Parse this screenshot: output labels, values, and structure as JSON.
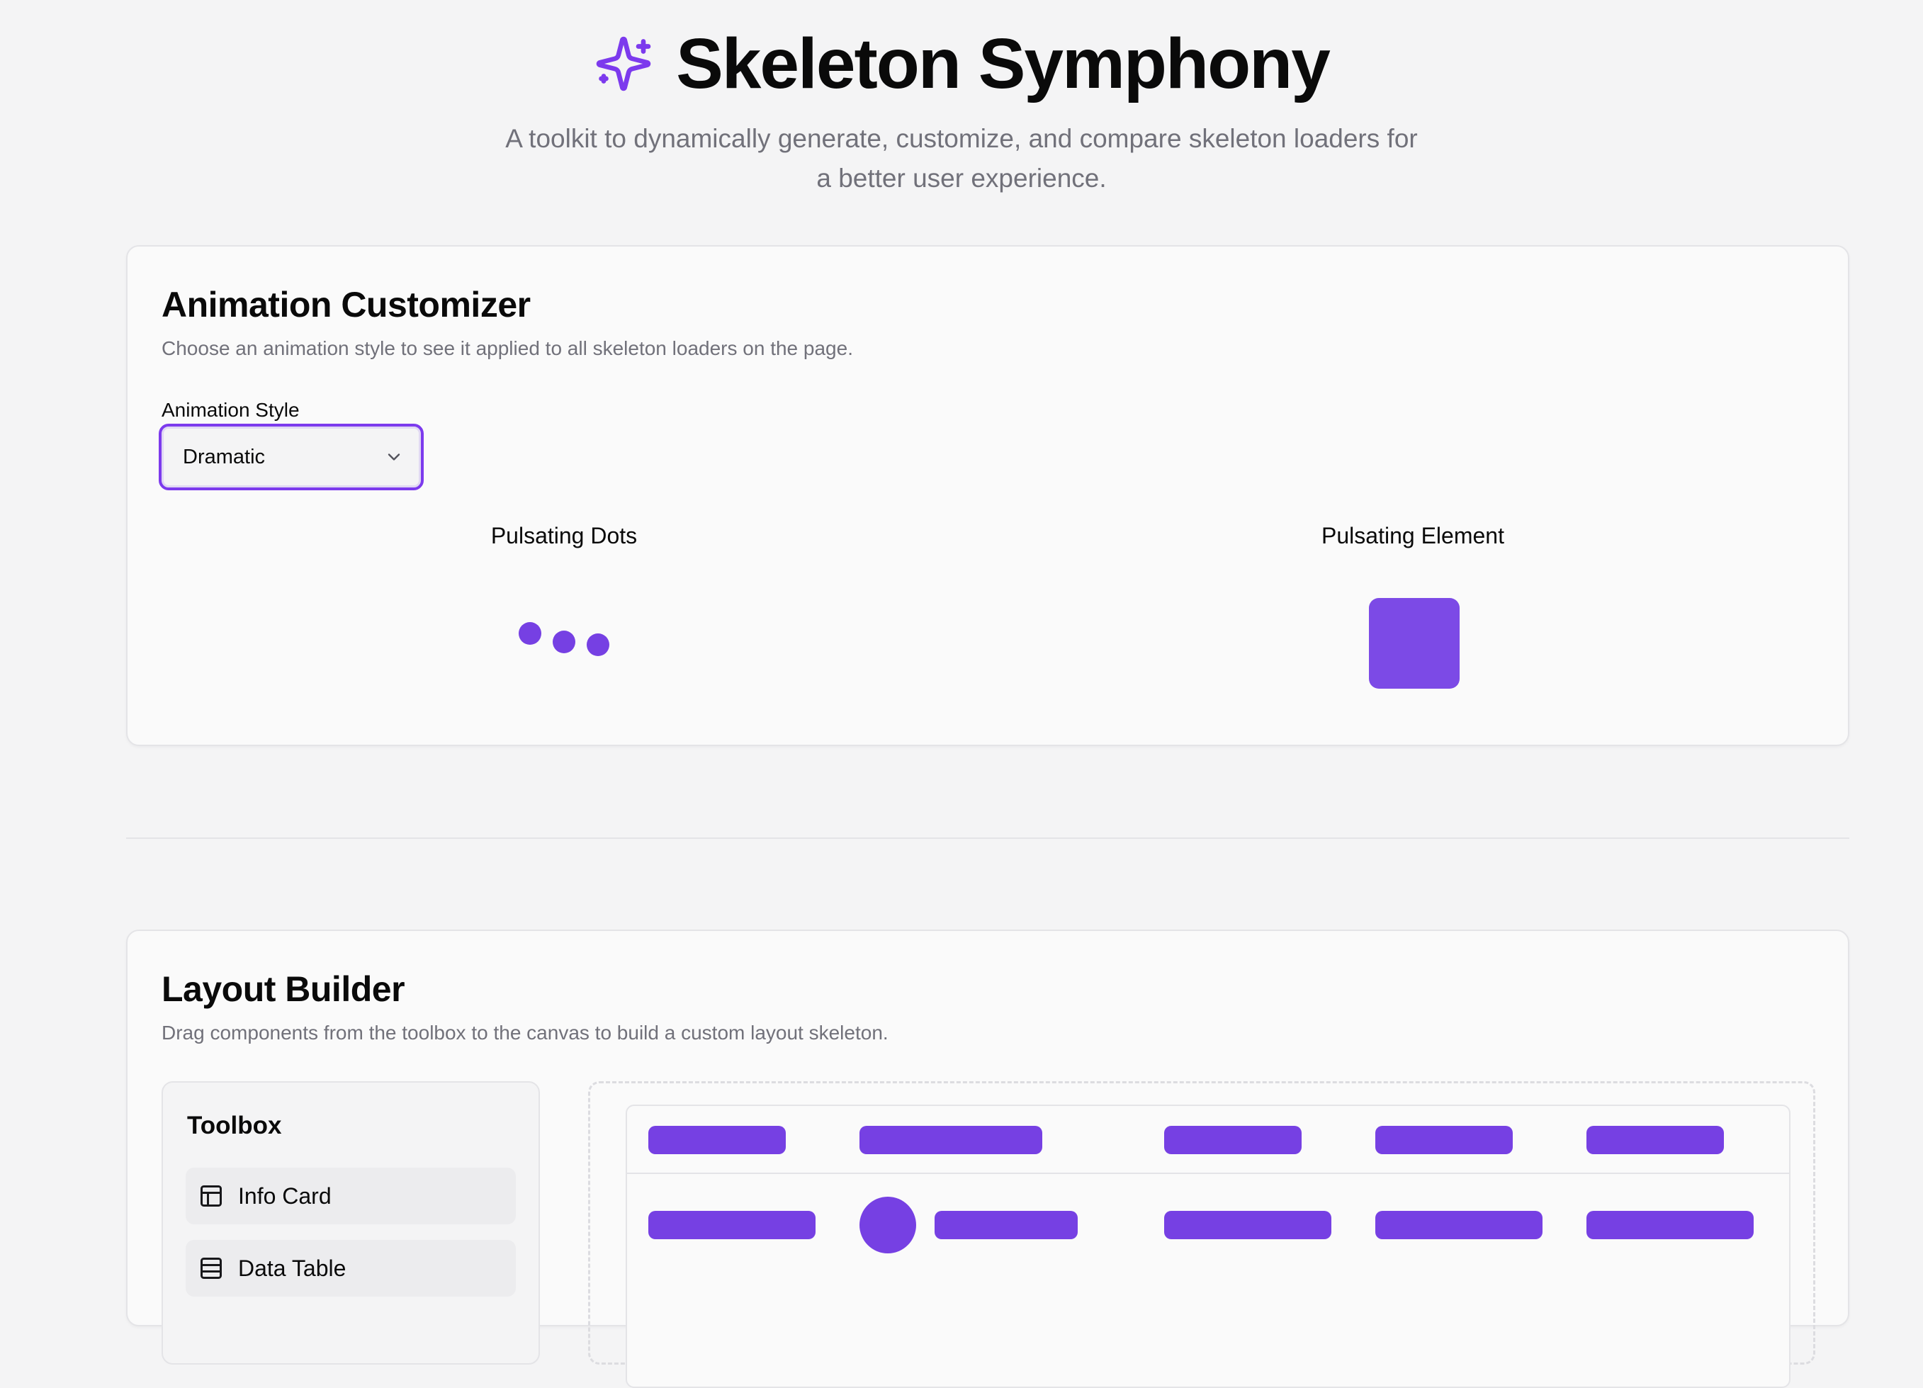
{
  "app": {
    "title": "Skeleton Symphony",
    "subtitle": "A toolkit to dynamically generate, customize, and compare skeleton loaders for a better user experience.",
    "icon": "sparkles-icon",
    "accent_color": "#7c3aed"
  },
  "customizer": {
    "title": "Animation Customizer",
    "description": "Choose an animation style to see it applied to all skeleton loaders on the page.",
    "field_label": "Animation Style",
    "selected_style": "Dramatic",
    "demos": [
      {
        "label": "Pulsating Dots"
      },
      {
        "label": "Pulsating Element"
      }
    ]
  },
  "builder": {
    "title": "Layout Builder",
    "description": "Drag components from the toolbox to the canvas to build a custom layout skeleton.",
    "toolbox": {
      "title": "Toolbox",
      "items": [
        {
          "label": "Info Card",
          "icon": "layout-panel-icon"
        },
        {
          "label": "Data Table",
          "icon": "table-icon"
        }
      ]
    }
  }
}
